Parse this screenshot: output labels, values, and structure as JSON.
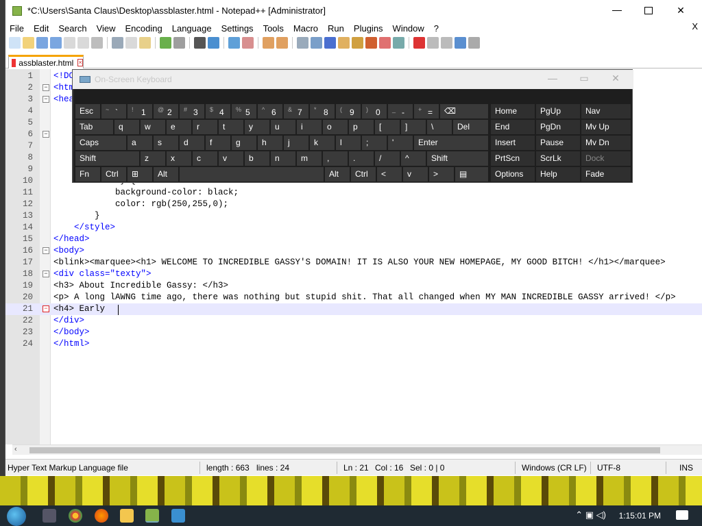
{
  "window": {
    "title": "*C:\\Users\\Santa Claus\\Desktop\\assblaster.html - Notepad++ [Administrator]",
    "menu": [
      "File",
      "Edit",
      "Search",
      "View",
      "Encoding",
      "Language",
      "Settings",
      "Tools",
      "Macro",
      "Run",
      "Plugins",
      "Window",
      "?"
    ],
    "menu_close": "X",
    "tab_label": "assblaster.html",
    "tab_close": "×"
  },
  "editor": {
    "lines": [
      {
        "n": "1",
        "code": "<!DOCTYPE html>"
      },
      {
        "n": "2",
        "code": "<html>"
      },
      {
        "n": "3",
        "code": "<head>"
      },
      {
        "n": "4",
        "code": ""
      },
      {
        "n": "5",
        "code": ""
      },
      {
        "n": "6",
        "code": ""
      },
      {
        "n": "7",
        "code": ""
      },
      {
        "n": "8",
        "code": ""
      },
      {
        "n": "9",
        "code": ""
      },
      {
        "n": "10",
        "code": "        .texty {"
      },
      {
        "n": "11",
        "code": "            background-color: black;"
      },
      {
        "n": "12",
        "code": "            color: rgb(250,255,0);"
      },
      {
        "n": "13",
        "code": "        }"
      },
      {
        "n": "14",
        "code": "    </style>"
      },
      {
        "n": "15",
        "code": "</head>"
      },
      {
        "n": "16",
        "code": "<body>"
      },
      {
        "n": "17",
        "code": "<blink><marquee><h1> WELCOME TO INCREDIBLE GASSY'S DOMAIN! IT IS ALSO YOUR NEW HOMEPAGE, MY GOOD BITCH! </h1></marquee>"
      },
      {
        "n": "18",
        "code": "<div class=\"texty\">"
      },
      {
        "n": "19",
        "code": "<h3> About Incredible Gassy: </h3>"
      },
      {
        "n": "20",
        "code": "<p> A long lAWNG time ago, there was nothing but stupid shit. That all changed when MY MAN INCREDIBLE GASSY arrived! </p>"
      },
      {
        "n": "21",
        "code": "<h4> Early "
      },
      {
        "n": "22",
        "code": "</div>"
      },
      {
        "n": "23",
        "code": "</body>"
      },
      {
        "n": "24",
        "code": "</html>"
      }
    ]
  },
  "status": {
    "file_type": "Hyper Text Markup Language file",
    "length": "length : 663",
    "lines": "lines : 24",
    "ln": "Ln : 21",
    "col": "Col : 16",
    "sel": "Sel : 0 | 0",
    "eol": "Windows (CR LF)",
    "encoding": "UTF-8",
    "mode": "INS"
  },
  "osk": {
    "title": "On-Screen Keyboard",
    "row1": [
      {
        "label": "Esc"
      },
      {
        "sub": "~",
        "main": "`"
      },
      {
        "sub": "!",
        "main": "1"
      },
      {
        "sub": "@",
        "main": "2"
      },
      {
        "sub": "#",
        "main": "3"
      },
      {
        "sub": "$",
        "main": "4"
      },
      {
        "sub": "%",
        "main": "5"
      },
      {
        "sub": "^",
        "main": "6"
      },
      {
        "sub": "&",
        "main": "7"
      },
      {
        "sub": "*",
        "main": "8"
      },
      {
        "sub": "(",
        "main": "9"
      },
      {
        "sub": ")",
        "main": "0"
      },
      {
        "sub": "_",
        "main": "-"
      },
      {
        "sub": "+",
        "main": "="
      },
      {
        "label": "⌫"
      }
    ],
    "row2": [
      "Tab",
      "q",
      "w",
      "e",
      "r",
      "t",
      "y",
      "u",
      "i",
      "o",
      "p",
      "[",
      "]",
      "\\",
      "Del"
    ],
    "row3": [
      "Caps",
      "a",
      "s",
      "d",
      "f",
      "g",
      "h",
      "j",
      "k",
      "l",
      ";",
      "'",
      "Enter"
    ],
    "row4": [
      "Shift",
      "z",
      "x",
      "c",
      "v",
      "b",
      "n",
      "m",
      ",",
      ".",
      "/",
      "^",
      "Shift"
    ],
    "row5": [
      "Fn",
      "Ctrl",
      "⊞",
      "Alt",
      "Alt",
      "Ctrl",
      "<",
      "v",
      ">",
      "▤"
    ],
    "side1": [
      "Home",
      "PgUp",
      "Nav"
    ],
    "side2": [
      "End",
      "PgDn",
      "Mv Up"
    ],
    "side3": [
      "Insert",
      "Pause",
      "Mv Dn"
    ],
    "side4": [
      "PrtScn",
      "ScrLk",
      "Dock"
    ],
    "side5": [
      "Options",
      "Help",
      "Fade"
    ]
  },
  "taskbar": {
    "clock": "1:15:01 PM"
  }
}
